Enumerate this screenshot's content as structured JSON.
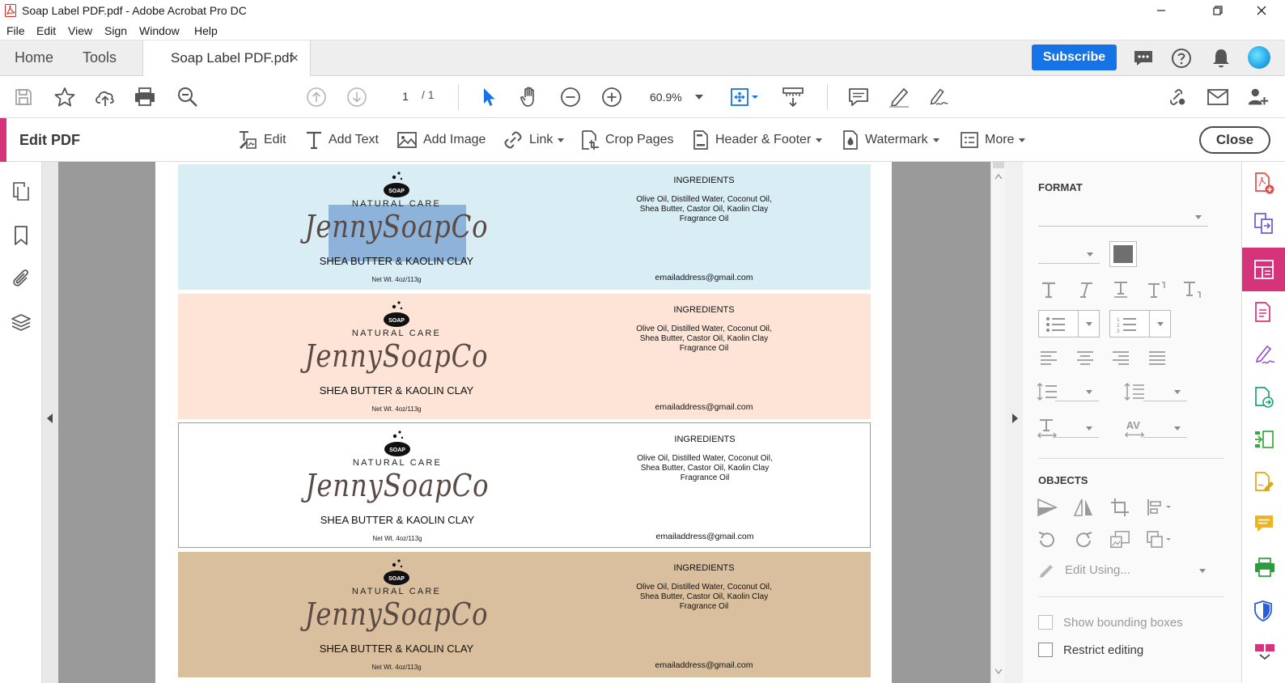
{
  "window": {
    "title": "Soap Label PDF.pdf - Adobe Acrobat Pro DC"
  },
  "menu": [
    "File",
    "Edit",
    "View",
    "Sign",
    "Window",
    "Help"
  ],
  "tabs": {
    "home": "Home",
    "tools": "Tools",
    "document": "Soap Label PDF.pdf",
    "close_glyph": "×"
  },
  "header": {
    "subscribe": "Subscribe"
  },
  "toolbar": {
    "page_current": "1",
    "page_total": "/ 1",
    "zoom": "60.9%"
  },
  "edit_bar": {
    "title": "Edit PDF",
    "tools": [
      {
        "name": "edit",
        "label": "Edit"
      },
      {
        "name": "add-text",
        "label": "Add Text"
      },
      {
        "name": "add-image",
        "label": "Add Image"
      },
      {
        "name": "link",
        "label": "Link"
      },
      {
        "name": "crop-pages",
        "label": "Crop Pages"
      },
      {
        "name": "header-footer",
        "label": "Header & Footer"
      },
      {
        "name": "watermark",
        "label": "Watermark"
      },
      {
        "name": "more",
        "label": "More"
      }
    ],
    "close": "Close"
  },
  "labels": [
    {
      "bg": "#d9edf5",
      "border": "none"
    },
    {
      "bg": "#fde4d7",
      "border": "none"
    },
    {
      "bg": "#ffffff",
      "border": "#9a9a9a"
    },
    {
      "bg": "#d9bf9d",
      "border": "none"
    }
  ],
  "label_content": {
    "logo_text": "SOAP",
    "tagline": "NATURAL CARE",
    "brand": "JennySoapCo",
    "product": "SHEA BUTTER & KAOLIN CLAY",
    "net_weight": "Net Wt. 4oz/113g",
    "ingredients_title": "INGREDIENTS",
    "ingredients_line1": "Olive Oil, Distilled Water, Coconut Oil,",
    "ingredients_line2": "Shea Butter, Castor Oil, Kaolin Clay",
    "ingredients_line3": "Fragrance Oil",
    "email": "emailaddress@gmail.com"
  },
  "format_panel": {
    "format_title": "FORMAT",
    "objects_title": "OBJECTS",
    "edit_using": "Edit Using...",
    "show_bounding_boxes": "Show bounding boxes",
    "restrict_editing": "Restrict editing"
  },
  "colors": {
    "accent": "#d5337a",
    "subscribe": "#1473e6",
    "selection": "#4e84c4"
  }
}
